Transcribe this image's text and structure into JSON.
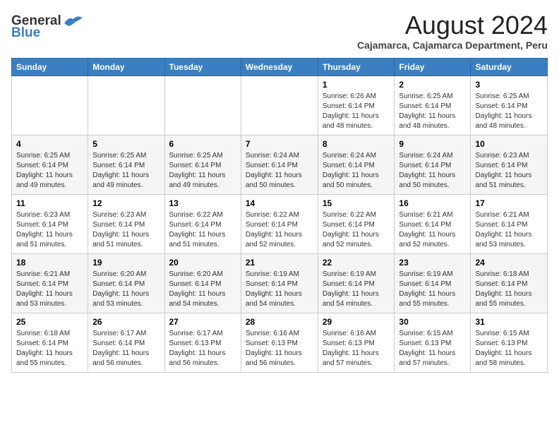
{
  "header": {
    "logo_line1": "General",
    "logo_line2": "Blue",
    "main_title": "August 2024",
    "subtitle": "Cajamarca, Cajamarca Department, Peru"
  },
  "calendar": {
    "days_of_week": [
      "Sunday",
      "Monday",
      "Tuesday",
      "Wednesday",
      "Thursday",
      "Friday",
      "Saturday"
    ],
    "weeks": [
      [
        {
          "day": "",
          "info": ""
        },
        {
          "day": "",
          "info": ""
        },
        {
          "day": "",
          "info": ""
        },
        {
          "day": "",
          "info": ""
        },
        {
          "day": "1",
          "info": "Sunrise: 6:26 AM\nSunset: 6:14 PM\nDaylight: 11 hours and 48 minutes."
        },
        {
          "day": "2",
          "info": "Sunrise: 6:25 AM\nSunset: 6:14 PM\nDaylight: 11 hours and 48 minutes."
        },
        {
          "day": "3",
          "info": "Sunrise: 6:25 AM\nSunset: 6:14 PM\nDaylight: 11 hours and 48 minutes."
        }
      ],
      [
        {
          "day": "4",
          "info": "Sunrise: 6:25 AM\nSunset: 6:14 PM\nDaylight: 11 hours and 49 minutes."
        },
        {
          "day": "5",
          "info": "Sunrise: 6:25 AM\nSunset: 6:14 PM\nDaylight: 11 hours and 49 minutes."
        },
        {
          "day": "6",
          "info": "Sunrise: 6:25 AM\nSunset: 6:14 PM\nDaylight: 11 hours and 49 minutes."
        },
        {
          "day": "7",
          "info": "Sunrise: 6:24 AM\nSunset: 6:14 PM\nDaylight: 11 hours and 50 minutes."
        },
        {
          "day": "8",
          "info": "Sunrise: 6:24 AM\nSunset: 6:14 PM\nDaylight: 11 hours and 50 minutes."
        },
        {
          "day": "9",
          "info": "Sunrise: 6:24 AM\nSunset: 6:14 PM\nDaylight: 11 hours and 50 minutes."
        },
        {
          "day": "10",
          "info": "Sunrise: 6:23 AM\nSunset: 6:14 PM\nDaylight: 11 hours and 51 minutes."
        }
      ],
      [
        {
          "day": "11",
          "info": "Sunrise: 6:23 AM\nSunset: 6:14 PM\nDaylight: 11 hours and 51 minutes."
        },
        {
          "day": "12",
          "info": "Sunrise: 6:23 AM\nSunset: 6:14 PM\nDaylight: 11 hours and 51 minutes."
        },
        {
          "day": "13",
          "info": "Sunrise: 6:22 AM\nSunset: 6:14 PM\nDaylight: 11 hours and 51 minutes."
        },
        {
          "day": "14",
          "info": "Sunrise: 6:22 AM\nSunset: 6:14 PM\nDaylight: 11 hours and 52 minutes."
        },
        {
          "day": "15",
          "info": "Sunrise: 6:22 AM\nSunset: 6:14 PM\nDaylight: 11 hours and 52 minutes."
        },
        {
          "day": "16",
          "info": "Sunrise: 6:21 AM\nSunset: 6:14 PM\nDaylight: 11 hours and 52 minutes."
        },
        {
          "day": "17",
          "info": "Sunrise: 6:21 AM\nSunset: 6:14 PM\nDaylight: 11 hours and 53 minutes."
        }
      ],
      [
        {
          "day": "18",
          "info": "Sunrise: 6:21 AM\nSunset: 6:14 PM\nDaylight: 11 hours and 53 minutes."
        },
        {
          "day": "19",
          "info": "Sunrise: 6:20 AM\nSunset: 6:14 PM\nDaylight: 11 hours and 53 minutes."
        },
        {
          "day": "20",
          "info": "Sunrise: 6:20 AM\nSunset: 6:14 PM\nDaylight: 11 hours and 54 minutes."
        },
        {
          "day": "21",
          "info": "Sunrise: 6:19 AM\nSunset: 6:14 PM\nDaylight: 11 hours and 54 minutes."
        },
        {
          "day": "22",
          "info": "Sunrise: 6:19 AM\nSunset: 6:14 PM\nDaylight: 11 hours and 54 minutes."
        },
        {
          "day": "23",
          "info": "Sunrise: 6:19 AM\nSunset: 6:14 PM\nDaylight: 11 hours and 55 minutes."
        },
        {
          "day": "24",
          "info": "Sunrise: 6:18 AM\nSunset: 6:14 PM\nDaylight: 11 hours and 55 minutes."
        }
      ],
      [
        {
          "day": "25",
          "info": "Sunrise: 6:18 AM\nSunset: 6:14 PM\nDaylight: 11 hours and 55 minutes."
        },
        {
          "day": "26",
          "info": "Sunrise: 6:17 AM\nSunset: 6:14 PM\nDaylight: 11 hours and 56 minutes."
        },
        {
          "day": "27",
          "info": "Sunrise: 6:17 AM\nSunset: 6:13 PM\nDaylight: 11 hours and 56 minutes."
        },
        {
          "day": "28",
          "info": "Sunrise: 6:16 AM\nSunset: 6:13 PM\nDaylight: 11 hours and 56 minutes."
        },
        {
          "day": "29",
          "info": "Sunrise: 6:16 AM\nSunset: 6:13 PM\nDaylight: 11 hours and 57 minutes."
        },
        {
          "day": "30",
          "info": "Sunrise: 6:15 AM\nSunset: 6:13 PM\nDaylight: 11 hours and 57 minutes."
        },
        {
          "day": "31",
          "info": "Sunrise: 6:15 AM\nSunset: 6:13 PM\nDaylight: 11 hours and 58 minutes."
        }
      ]
    ]
  }
}
